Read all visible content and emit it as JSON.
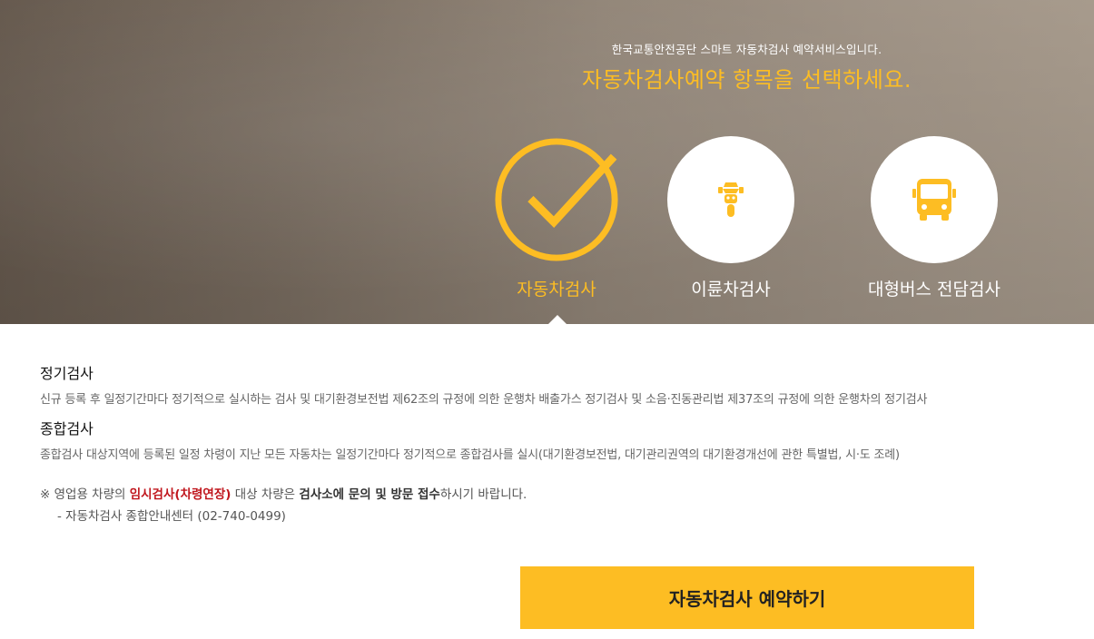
{
  "hero": {
    "subtitle": "한국교통안전공단 스마트 자동차검사 예약서비스입니다.",
    "title": "자동차검사예약 항목을 선택하세요."
  },
  "options": [
    {
      "label": "자동차검사",
      "icon": "check-icon",
      "selected": true
    },
    {
      "label": "이륜차검사",
      "icon": "motorcycle-icon",
      "selected": false
    },
    {
      "label": "대형버스 전담검사",
      "icon": "bus-icon",
      "selected": false
    }
  ],
  "descriptions": [
    {
      "heading": "정기검사",
      "text": "신규 등록 후 일정기간마다 정기적으로 실시하는 검사 및 대기환경보전법 제62조의 규정에 의한 운행차 배출가스 정기검사 및 소음·진동관리법 제37조의 규정에 의한 운행차의 정기검사"
    },
    {
      "heading": "종합검사",
      "text": "종합검사 대상지역에 등록된 일정 차령이 지난 모든 자동차는 일정기간마다 정기적으로 종합검사를 실시(대기환경보전법, 대기관리권역의 대기환경개선에 관한 특별법, 시·도 조례)"
    }
  ],
  "notice": {
    "prefix": "※ 영업용 차량의 ",
    "highlight": "임시검사(차령연장)",
    "middle": " 대상 차량은 ",
    "emphasis": "검사소에 문의 및 방문 접수",
    "suffix": "하시기 바랍니다.",
    "contact": "- 자동차검사 종합안내센터 (02-740-0499)"
  },
  "cta": {
    "label": "자동차검사 예약하기"
  },
  "colors": {
    "accent": "#fdbd23",
    "highlight": "#c0161d"
  }
}
